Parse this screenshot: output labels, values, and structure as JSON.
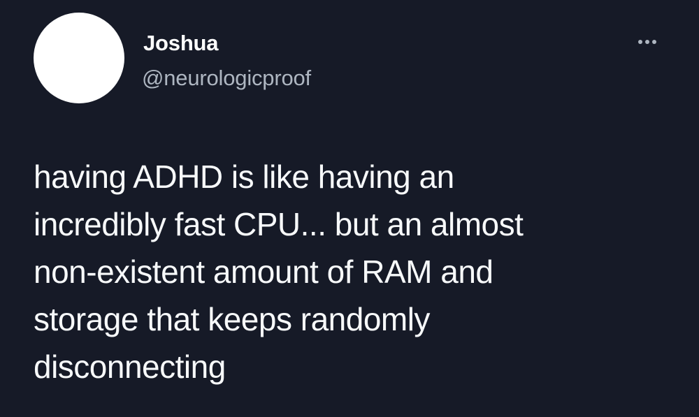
{
  "tweet": {
    "author": {
      "display_name": "Joshua",
      "handle": "@neurologicproof"
    },
    "more_button_icon": "more-horizontal-icon",
    "text_lines": [
      "having ADHD is like having an",
      "incredibly fast CPU... but an almost",
      "non-existent amount of RAM and",
      "storage that keeps randomly",
      "disconnecting"
    ]
  },
  "colors": {
    "background": "#161a27",
    "text_primary": "#f7f9fa",
    "text_secondary": "#aeb6c1"
  }
}
